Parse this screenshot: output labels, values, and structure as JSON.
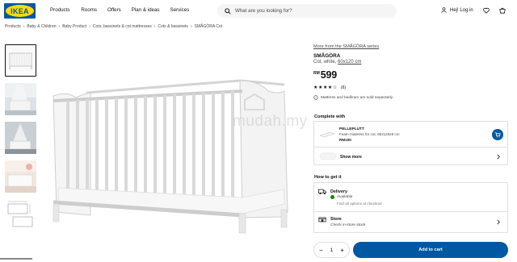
{
  "header": {
    "logo_text": "IKEA",
    "nav": [
      "Products",
      "Rooms",
      "Offers",
      "Plan & ideas",
      "Services"
    ],
    "search_placeholder": "What are you looking for?",
    "login_label": "Hej! Log in"
  },
  "breadcrumb": [
    "Products",
    "Baby & Children",
    "Baby Product",
    "Cots, bassinets & cot mattresses",
    "Cots & bassinets",
    "SMÅGÖRA Cot"
  ],
  "product": {
    "more_series": "More from the SMÅGÖRA series",
    "name": "SMÅGÖRA",
    "desc_prefix": "Cot, white, ",
    "desc_size": "60x120 cm",
    "currency": "RM",
    "price": "599",
    "stars": "★★★★☆",
    "review_count": "(6)",
    "note": "Mattress and bedlinen are sold separately."
  },
  "complete": {
    "title": "Complete with",
    "item_name": "PELLEPLUTT",
    "item_desc": "Foam mattress for cot, 60x120x6 cm",
    "item_price": "RM100",
    "show_more": "Show more"
  },
  "how": {
    "title": "How to get it",
    "delivery_title": "Delivery",
    "delivery_status": "Available",
    "delivery_sub": "Find all options at checkout",
    "store_title": "Store",
    "store_sub": "Check in-store stock"
  },
  "purchase": {
    "qty": "1",
    "minus": "−",
    "plus": "+",
    "add_to_cart": "Add to cart"
  },
  "watermark": "mudah.my",
  "colors": {
    "ikea_blue": "#0058a3",
    "ikea_yellow": "#ffdb00",
    "available_green": "#0a8a00"
  }
}
